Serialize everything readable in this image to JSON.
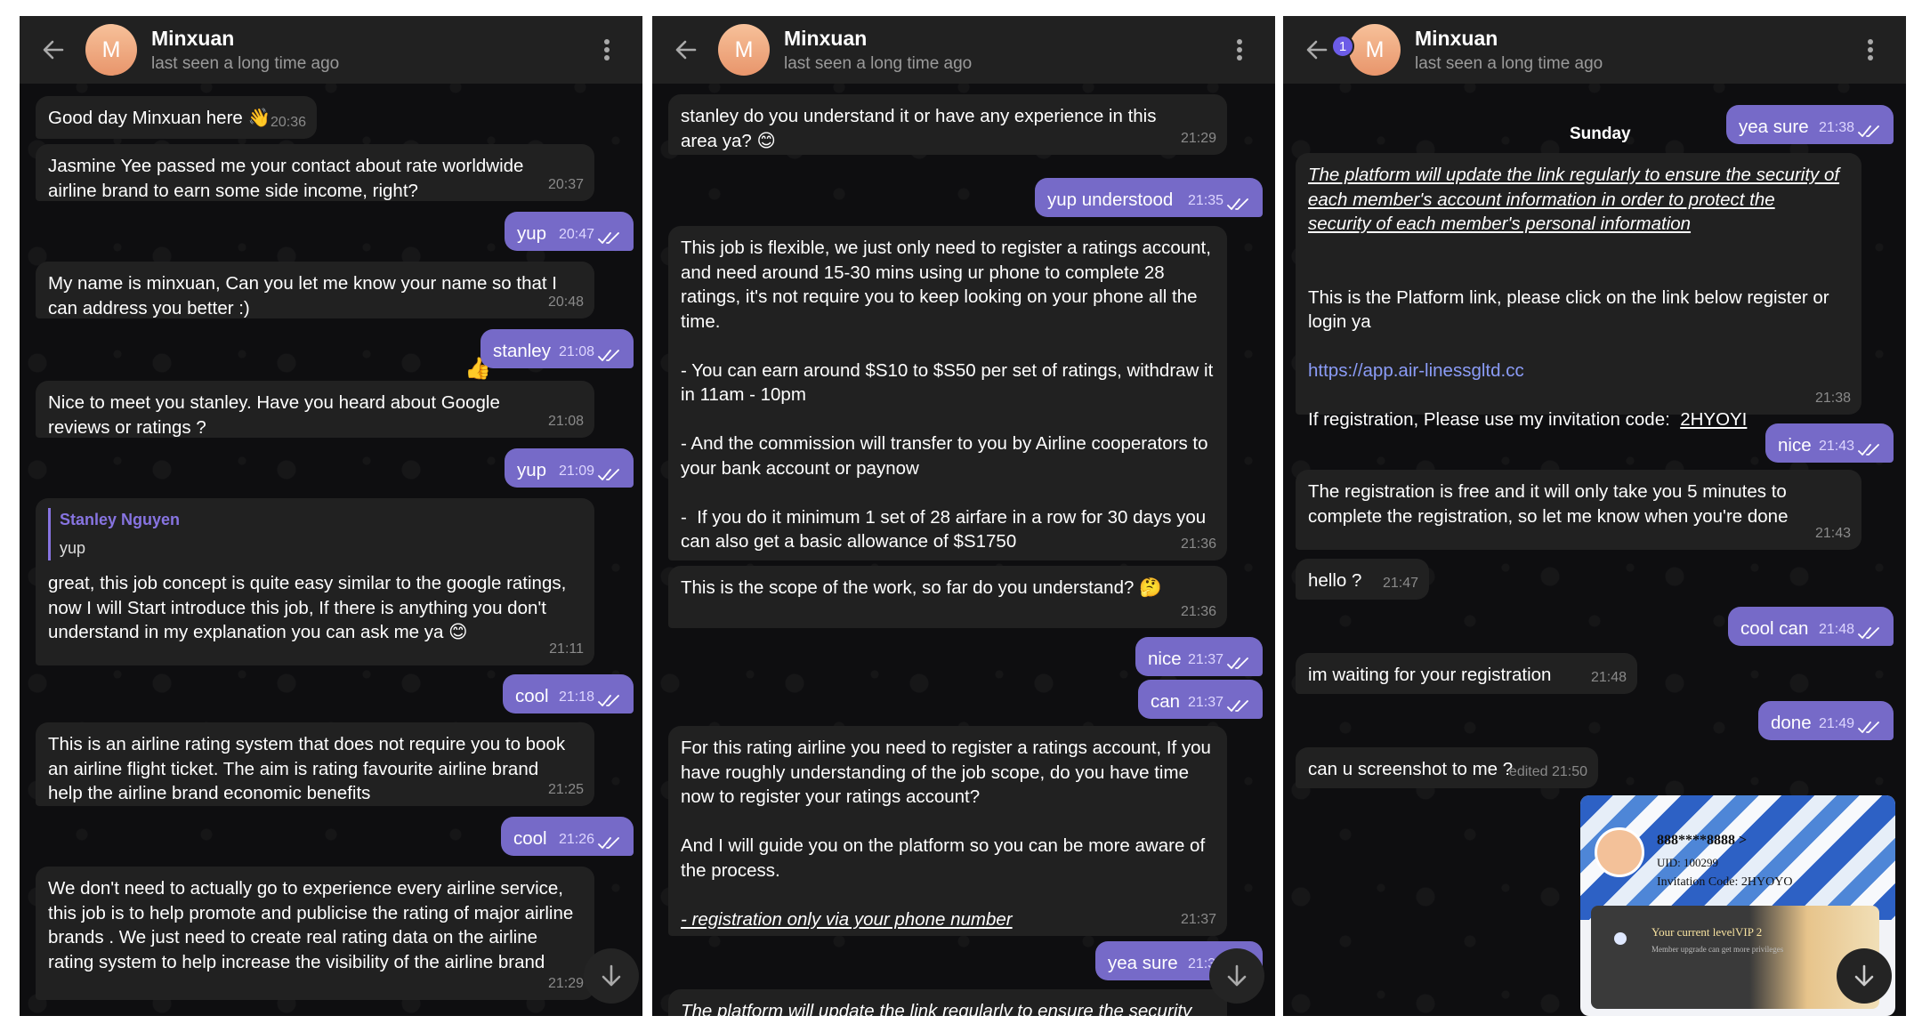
{
  "header": {
    "name": "Minxuan",
    "status": "last seen a long time ago",
    "avatar_letter": "M",
    "unread_badge": "1"
  },
  "colors": {
    "background": "#0e0e10",
    "header": "#212121",
    "incoming_bubble": "#212121",
    "outgoing_bubble": "#766ac8",
    "accent": "#8774e1"
  },
  "icons": {
    "back": "arrow-left-icon",
    "menu": "more-vertical-icon",
    "read": "double-check-icon",
    "scroll_down": "arrow-down-icon"
  },
  "panels": [
    {
      "messages": [
        {
          "dir": "in",
          "text": "Good day Minxuan here 👋",
          "time": "20:36"
        },
        {
          "dir": "in",
          "text": "Jasmine Yee passed me your contact about rate worldwide airline brand to earn some side income, right?",
          "time": "20:37"
        },
        {
          "dir": "out",
          "text": "yup",
          "time": "20:47"
        },
        {
          "dir": "in",
          "text": "My name is minxuan, Can you let me know your name so that I can address you better :)",
          "time": "20:48"
        },
        {
          "dir": "out",
          "text": "stanley",
          "time": "21:08",
          "reaction": "👍"
        },
        {
          "dir": "in",
          "text": "Nice to meet you stanley. Have you heard about Google reviews or ratings ?",
          "time": "21:08"
        },
        {
          "dir": "out",
          "text": "yup",
          "time": "21:09"
        },
        {
          "dir": "in",
          "reply_name": "Stanley Nguyen",
          "reply_text": "yup",
          "text": "great, this job concept is quite easy similar to the google ratings, now I will Start introduce this job, If there is anything you don't understand in my explanation you can ask me ya 😊",
          "time": "21:11"
        },
        {
          "dir": "out",
          "text": "cool",
          "time": "21:18"
        },
        {
          "dir": "in",
          "text": "This is an airline rating system that does not require you to book an airline flight ticket. The aim is rating favourite airline brand help the airline brand economic benefits",
          "time": "21:25"
        },
        {
          "dir": "out",
          "text": "cool",
          "time": "21:26"
        },
        {
          "dir": "in",
          "text": "We don't need to actually go to experience every airline service, this job is to help promote and publicise the rating of major airline brands . We just need to create real rating data on the airline rating system to help increase the visibility of the airline brand",
          "time": "21:29"
        }
      ]
    },
    {
      "messages": [
        {
          "dir": "in",
          "text": "stanley do you understand it or have any experience in this area ya? 😊",
          "time": "21:29"
        },
        {
          "dir": "out",
          "text": "yup understood",
          "time": "21:35"
        },
        {
          "dir": "in",
          "text": "This job is flexible, we just only need to register a ratings account, and need around 15-30 mins using ur phone to complete 28 ratings, it's not require you to keep looking on your phone all the time.\n\n- You can earn around $S10 to $S50 per set of ratings, withdraw it in 11am - 10pm\n\n- And the commission will transfer to you by Airline cooperators to your bank account or paynow\n\n-  If you do it minimum 1 set of 28 airfare in a row for 30 days you can also get a basic allowance of $S1750",
          "time": "21:36"
        },
        {
          "dir": "in",
          "text": "This is the scope of the work, so far do you understand? 🤔",
          "time": "21:36"
        },
        {
          "dir": "out",
          "text": "nice",
          "time": "21:37"
        },
        {
          "dir": "out",
          "text": "can",
          "time": "21:37"
        },
        {
          "dir": "in",
          "text": "For this rating airline you need to register a ratings account, If you have roughly understanding of the job scope, do you have time now to register your ratings account?\n\nAnd I will guide you on the platform so you can be more aware of the process.\n\n",
          "underline": "- registration only via your phone number",
          "time": "21:37"
        },
        {
          "dir": "out",
          "text": "yea sure",
          "time": "21:38"
        },
        {
          "dir": "in",
          "underline": "The platform will update the link regularly to ensure the security of each member's account information in order to",
          "time": ""
        }
      ]
    },
    {
      "date_label": "Sunday",
      "messages": [
        {
          "dir": "out",
          "text": "yea sure",
          "time": "21:38"
        },
        {
          "dir": "in",
          "underline": "The platform will update the link regularly to ensure the security of each member's account information in order to protect the security of each member's personal information",
          "text": "\n\nThis is the Platform link, please click on the link below register or login ya\n\n",
          "link": "https://app.air-linessgltd.cc",
          "text2": "\n\nIf registration, Please use my invitation code:  ",
          "code": "2HYOYI",
          "time": "21:38"
        },
        {
          "dir": "out",
          "text": "nice",
          "time": "21:43"
        },
        {
          "dir": "in",
          "text": "The registration is free and it will only take you 5 minutes to complete the registration, so let me know when you're done",
          "time": "21:43"
        },
        {
          "dir": "in",
          "text": "hello ?",
          "time": "21:47"
        },
        {
          "dir": "out",
          "text": "cool can",
          "time": "21:48"
        },
        {
          "dir": "in",
          "text": "im waiting for your registration",
          "time": "21:48"
        },
        {
          "dir": "out",
          "text": "done",
          "time": "21:49"
        },
        {
          "dir": "in",
          "text": "can u screenshot to me ?",
          "time": "edited 21:50"
        }
      ],
      "screenshot": {
        "phone": "888****8888 >",
        "uid": "UID: 100299",
        "invitation": "Invitation Code: 2HYOYO",
        "level": "Your current levelVIP 2",
        "level_note": "Member upgrade can get more privileges"
      }
    }
  ]
}
